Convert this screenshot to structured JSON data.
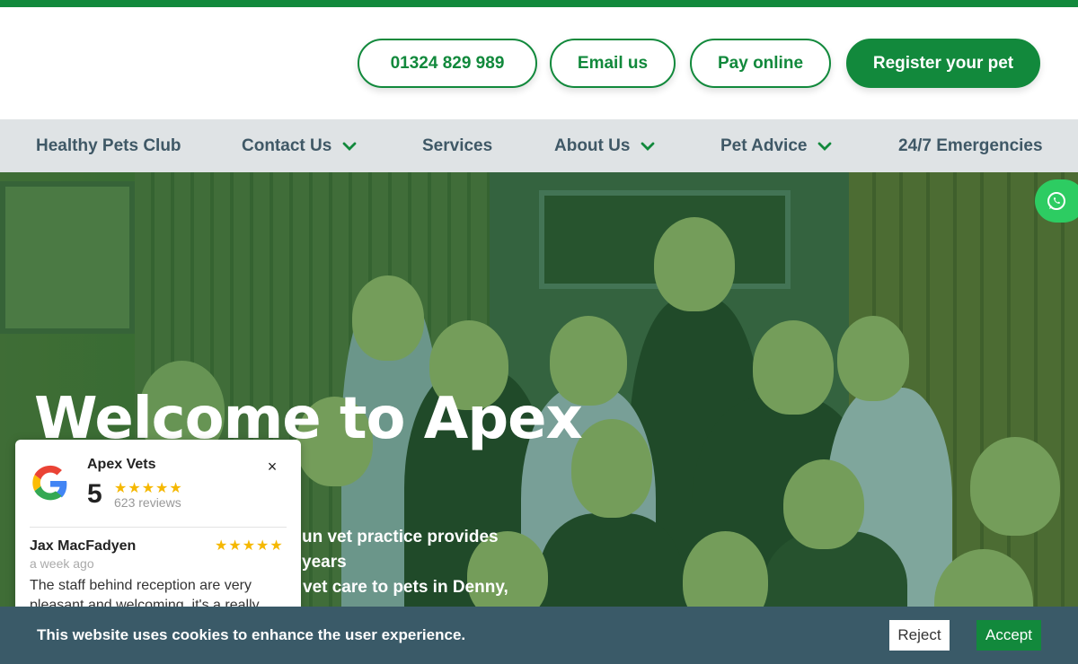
{
  "header": {
    "phone_label": "01324 829 989",
    "email_label": "Email us",
    "pay_label": "Pay online",
    "register_label": "Register your pet"
  },
  "nav": {
    "items": [
      {
        "label": "Healthy Pets Club",
        "has_dropdown": false
      },
      {
        "label": "Contact Us",
        "has_dropdown": true
      },
      {
        "label": "Services",
        "has_dropdown": false
      },
      {
        "label": "About Us",
        "has_dropdown": true
      },
      {
        "label": "Pet Advice",
        "has_dropdown": true
      },
      {
        "label": "24/7 Emergencies",
        "has_dropdown": false
      }
    ]
  },
  "hero": {
    "title": "Welcome to Apex",
    "text_line1": "un vet practice provides years",
    "text_line2": "vet care to pets in Denny,"
  },
  "review_widget": {
    "business_name": "Apex Vets",
    "rating": "5",
    "stars": "★★★★★",
    "review_count": "623 reviews",
    "close_icon": "×",
    "review": {
      "author": "Jax MacFadyen",
      "stars": "★★★★★",
      "date": "a week ago",
      "body": "The staff behind reception are very pleasant and welcoming, it's a really"
    }
  },
  "cookie_banner": {
    "text": "This website uses cookies to enhance the user experience.",
    "reject_label": "Reject",
    "accept_label": "Accept"
  },
  "colors": {
    "brand_green": "#12893c",
    "nav_bg": "#dfe3e5",
    "nav_text": "#3f5866",
    "cookie_bg": "#3a5a68",
    "whatsapp_green": "#2dcc62",
    "star_yellow": "#f5b800"
  },
  "icons": [
    "chevron-down-icon",
    "whatsapp-icon",
    "google-logo-icon",
    "close-icon",
    "star-icon"
  ]
}
